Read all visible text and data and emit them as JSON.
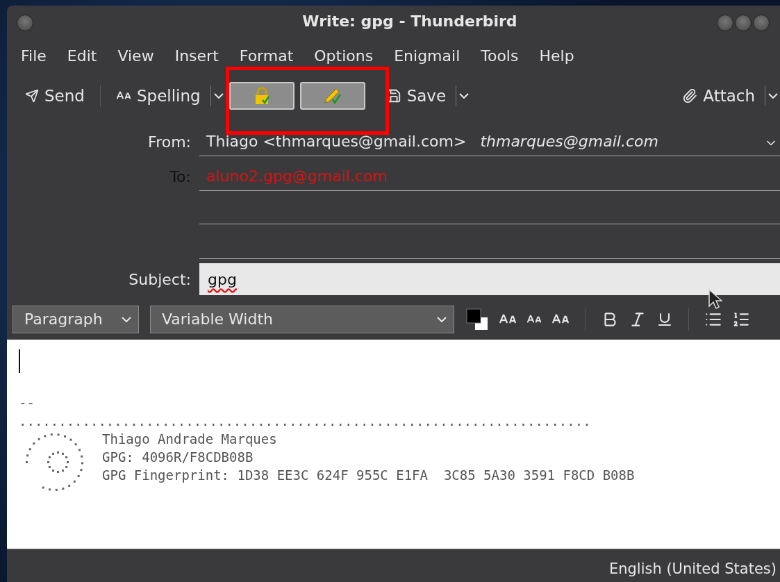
{
  "window": {
    "title": "Write: gpg - Thunderbird"
  },
  "menu": [
    "File",
    "Edit",
    "View",
    "Insert",
    "Format",
    "Options",
    "Enigmail",
    "Tools",
    "Help"
  ],
  "toolbar": {
    "send": "Send",
    "spelling": "Spelling",
    "save": "Save",
    "attach": "Attach"
  },
  "header": {
    "from": {
      "label": "From:",
      "name": "Thiago <thmarques@gmail.com>",
      "identity": "thmarques@gmail.com"
    },
    "recipients": [
      {
        "label": "To:",
        "address": "aluno2.gpg@gmail.com"
      }
    ],
    "subject": {
      "label": "Subject:",
      "value": "gpg"
    }
  },
  "format_bar": {
    "paragraph": "Paragraph",
    "font": "Variable Width"
  },
  "body": {
    "separator": "--",
    "rule": "........................................................................",
    "signature": [
      "Thiago Andrade Marques",
      "GPG: 4096R/F8CDB08B",
      "GPG Fingerprint: 1D38 EE3C 624F 955C E1FA  3C85 5A30 3591 F8CD B08B"
    ]
  },
  "status_bar": {
    "language": "English (United States)"
  }
}
